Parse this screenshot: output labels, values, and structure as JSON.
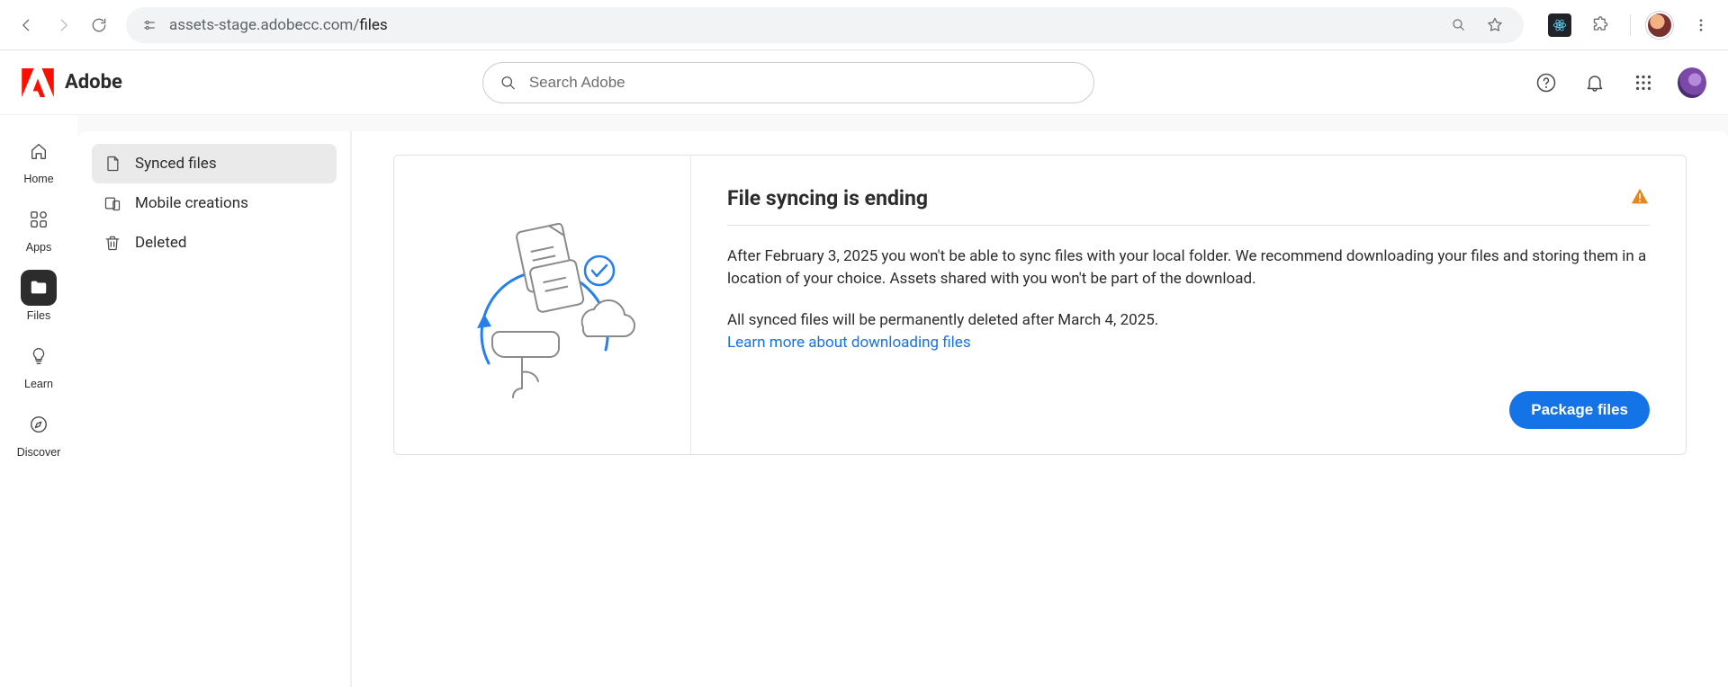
{
  "browser": {
    "url_host": "assets-stage.adobecc.com/",
    "url_path": "files"
  },
  "brand": {
    "name": "Adobe"
  },
  "search": {
    "placeholder": "Search Adobe"
  },
  "rail": {
    "home": "Home",
    "apps": "Apps",
    "files": "Files",
    "learn": "Learn",
    "discover": "Discover"
  },
  "sidebar": {
    "items": [
      {
        "label": "Synced files"
      },
      {
        "label": "Mobile creations"
      },
      {
        "label": "Deleted"
      }
    ]
  },
  "notice": {
    "title": "File syncing is ending",
    "p1": "After February 3, 2025 you won't be able to sync files with your local folder. We recommend downloading your files and storing them in a location of your choice. Assets shared with you won't be part of the download.",
    "p2": "All synced files will be permanently deleted after March 4, 2025.",
    "learn_link": "Learn more about downloading files",
    "cta": "Package files"
  }
}
